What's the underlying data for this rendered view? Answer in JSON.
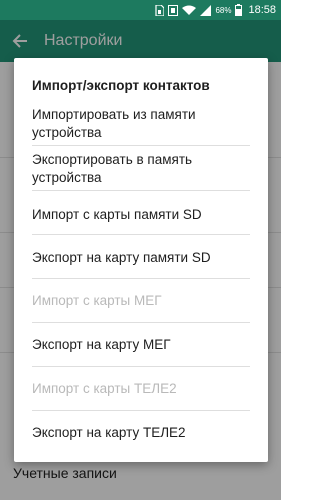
{
  "status_bar": {
    "battery_percent": "68%",
    "time": "18:58",
    "icons": [
      "sim-card-icon",
      "hands-free-icon",
      "wifi-icon",
      "signal-icon",
      "battery-icon"
    ]
  },
  "toolbar": {
    "title": "Настройки",
    "back_icon": "arrow-left-icon"
  },
  "background": {
    "bottom_item": "Учетные записи"
  },
  "dialog": {
    "title": "Импорт/экспорт контактов",
    "options": [
      {
        "label": "Импортировать из памяти устройства",
        "enabled": true
      },
      {
        "label": "Экспортировать в память устройства",
        "enabled": true
      },
      {
        "label": "Импорт с карты памяти SD",
        "enabled": true
      },
      {
        "label": "Экспорт на карту памяти SD",
        "enabled": true
      },
      {
        "label": "Импорт с карты МЕГ",
        "enabled": false
      },
      {
        "label": "Экспорт на карту МЕГ",
        "enabled": true
      },
      {
        "label": "Импорт с карты ТЕЛЕ2",
        "enabled": false
      },
      {
        "label": "Экспорт на карту ТЕЛЕ2",
        "enabled": true
      }
    ]
  },
  "colors": {
    "status_bar": "#1d7a5f",
    "toolbar": "#23977a",
    "text_enabled": "#1e1e1e",
    "text_disabled": "#b9b9b9"
  }
}
